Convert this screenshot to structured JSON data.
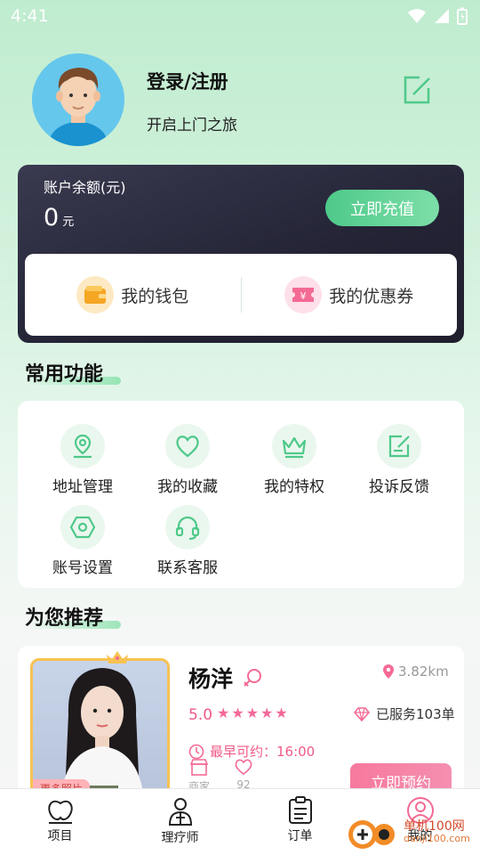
{
  "status_bar": {
    "time": "4:41"
  },
  "profile": {
    "title": "登录/注册",
    "subtitle": "开启上门之旅"
  },
  "balance": {
    "label": "账户余额(元)",
    "amount": "0",
    "unit": "元",
    "recharge_label": "立即充值",
    "wallet_label": "我的钱包",
    "coupon_label": "我的优惠券"
  },
  "common_functions": {
    "title": "常用功能",
    "items": [
      {
        "label": "地址管理",
        "icon": "location-icon"
      },
      {
        "label": "我的收藏",
        "icon": "heart-icon"
      },
      {
        "label": "我的特权",
        "icon": "crown-icon"
      },
      {
        "label": "投诉反馈",
        "icon": "feedback-icon"
      },
      {
        "label": "账号设置",
        "icon": "hexagon-settings-icon"
      },
      {
        "label": "联系客服",
        "icon": "headset-icon"
      }
    ]
  },
  "recommend": {
    "title": "为您推荐",
    "therapist": {
      "name": "杨洋",
      "distance": "3.82km",
      "rating": "5.0",
      "stars": 5,
      "served": "已服务103单",
      "earliest": "最早可约：16:00",
      "more_photos": "更多照片",
      "shop_label": "商家",
      "likes": "92",
      "book_label": "立即预约"
    }
  },
  "tabs": [
    {
      "label": "项目",
      "icon": "project-icon"
    },
    {
      "label": "理疗师",
      "icon": "therapist-icon"
    },
    {
      "label": "订单",
      "icon": "order-icon"
    },
    {
      "label": "我的",
      "icon": "profile-icon"
    }
  ],
  "watermark": {
    "text": "单机100网",
    "url": "danji100.com"
  },
  "colors": {
    "accent_green": "#4ec98a",
    "accent_pink": "#f05a86",
    "card_dark": "#232335"
  }
}
